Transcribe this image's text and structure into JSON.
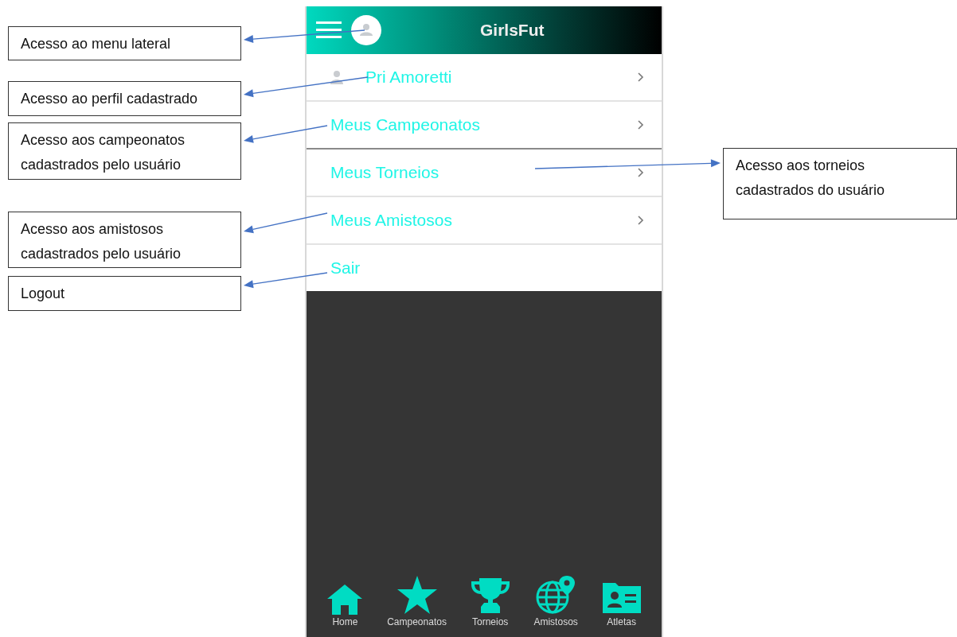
{
  "app_bar": {
    "title": "GirlsFut"
  },
  "menu": [
    {
      "label": "Pri Amoretti",
      "kind": "profile",
      "chevron": true
    },
    {
      "label": "Meus Campeonatos",
      "kind": "plain",
      "chevron": true
    },
    {
      "label": "Meus Torneios",
      "kind": "plain",
      "chevron": true
    },
    {
      "label": "Meus Amistosos",
      "kind": "plain",
      "chevron": true
    },
    {
      "label": "Sair",
      "kind": "plain",
      "chevron": false
    }
  ],
  "bottom_nav": [
    {
      "label": "Home"
    },
    {
      "label": "Campeonatos"
    },
    {
      "label": "Torneios"
    },
    {
      "label": "Amistosos"
    },
    {
      "label": "Atletas"
    }
  ],
  "annotations": [
    {
      "text": "Acesso ao menu lateral"
    },
    {
      "text": "Acesso ao perfil cadastrado"
    },
    {
      "text": "Acesso aos campeonatos cadastrados pelo usuário"
    },
    {
      "text": "Acesso aos amistosos cadastrados pelo usuário"
    },
    {
      "text": "Logout"
    },
    {
      "text": "Acesso aos torneios cadastrados do usuário"
    }
  ]
}
